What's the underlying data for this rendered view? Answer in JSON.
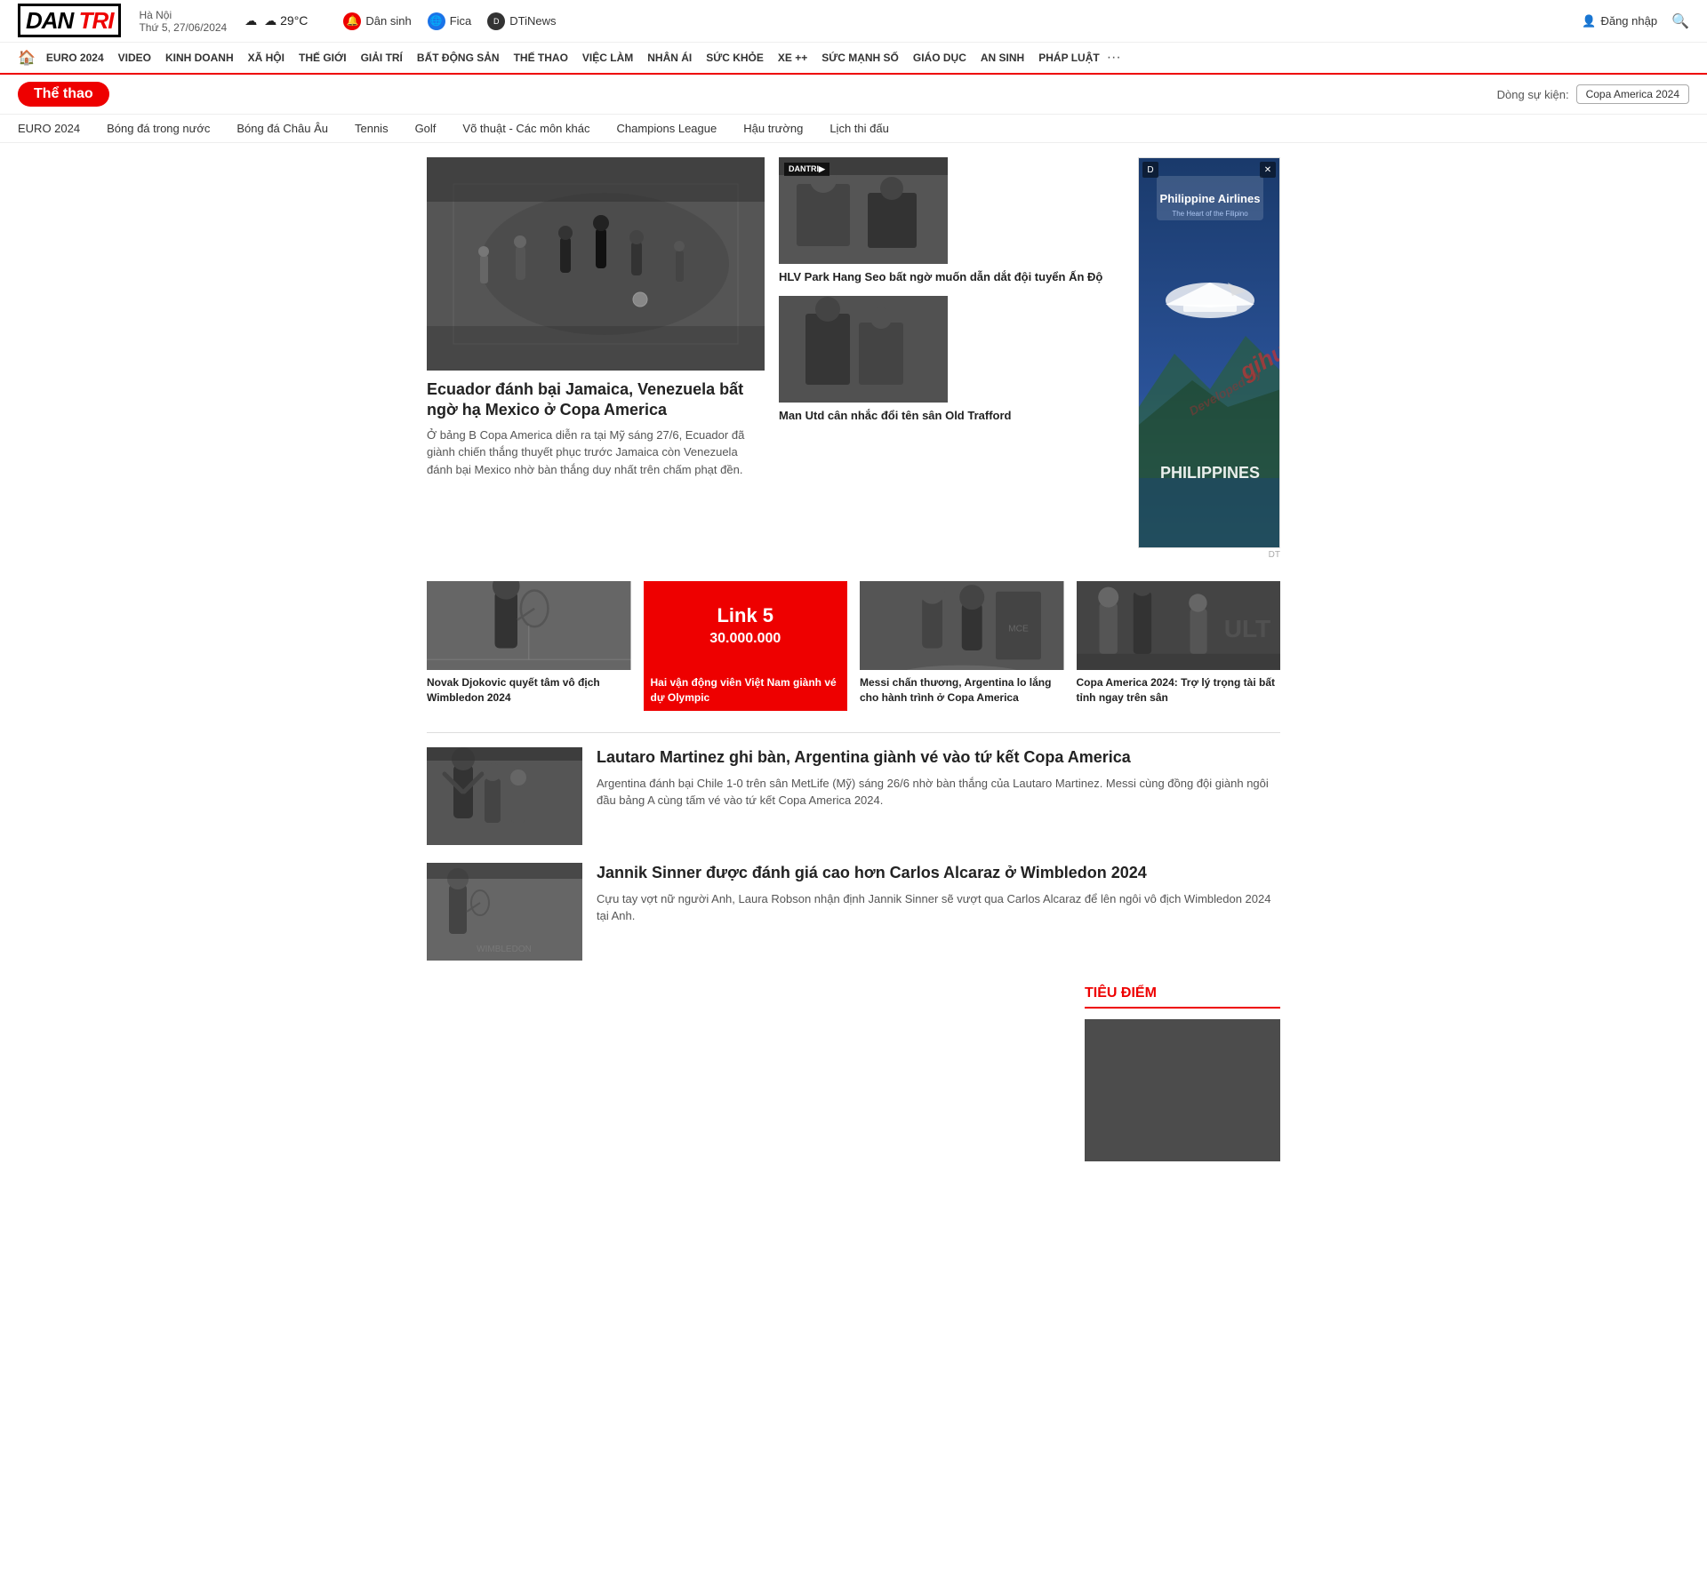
{
  "site": {
    "logo": "DAN TRI",
    "logo_dan": "DAN",
    "logo_tri": "TRI"
  },
  "header": {
    "day": "Thứ 5, 27/06/2024",
    "city": "Hà Nội",
    "weather": "☁ 29°C",
    "links": [
      {
        "id": "dan-sinh",
        "label": "Dân sinh",
        "icon": "🔔"
      },
      {
        "id": "fica",
        "label": "Fica",
        "icon": "🌐"
      },
      {
        "id": "dtinews",
        "label": "DTiNews",
        "icon": "D"
      }
    ],
    "login": "Đăng nhập"
  },
  "main_nav": {
    "items": [
      "EURO 2024",
      "VIDEO",
      "KINH DOANH",
      "XÃ HỘI",
      "THẾ GIỚI",
      "GIẢI TRÍ",
      "BẤT ĐỘNG SẢN",
      "THẾ THAO",
      "VIỆC LÀM",
      "NHÂN ÁI",
      "SỨC KHỎE",
      "XE ++",
      "SỨC MẠNH SỐ",
      "GIÁO DỤC",
      "AN SINH",
      "PHÁP LUẬT"
    ],
    "more": "..."
  },
  "section": {
    "badge": "Thể thao",
    "trending_label": "Dòng sự kiện:",
    "trending_tag": "Copa America 2024"
  },
  "sub_nav": {
    "items": [
      "EURO 2024",
      "Bóng đá trong nước",
      "Bóng đá Châu Âu",
      "Tennis",
      "Golf",
      "Võ thuật - Các môn khác",
      "Champions League",
      "Hậu trường",
      "Lịch thi đấu"
    ]
  },
  "main_article": {
    "title": "Ecuador đánh bại Jamaica, Venezuela bất ngờ hạ Mexico ở Copa America",
    "summary": "Ở bảng B Copa America diễn ra tại Mỹ sáng 27/6, Ecuador đã giành chiến thắng thuyết phục trước Jamaica còn Venezuela đánh bại Mexico nhờ bàn thắng duy nhất trên chấm phạt đền."
  },
  "side_articles": [
    {
      "title": "HLV Park Hang Seo bất ngờ muốn dẫn dắt đội tuyển Ấn Độ"
    },
    {
      "title": "Man Utd cân nhắc đổi tên sân Old Trafford"
    }
  ],
  "small_articles": [
    {
      "type": "normal",
      "title": "Novak Djokovic quyết tâm vô địch Wimbledon 2024"
    },
    {
      "type": "highlight",
      "link_text": "Link 5",
      "link_amount": "30.000.000",
      "title": "Hai vận động viên Việt Nam giành vé dự Olympic"
    },
    {
      "type": "normal",
      "title": "Messi chấn thương, Argentina lo lắng cho hành trình ở Copa America"
    },
    {
      "type": "normal",
      "title": "Copa America 2024: Trợ lý trọng tài bất tỉnh ngay trên sân"
    }
  ],
  "list_articles": [
    {
      "title": "Lautaro Martinez ghi bàn, Argentina giành vé vào tứ kết Copa America",
      "summary": "Argentina đánh bại Chile 1-0 trên sân MetLife (Mỹ) sáng 26/6 nhờ bàn thắng của Lautaro Martinez. Messi cùng đồng đội giành ngôi đầu bảng A cùng tấm vé vào tứ kết Copa America 2024."
    },
    {
      "title": "Jannik Sinner được đánh giá cao hơn Carlos Alcaraz ở Wimbledon 2024",
      "summary": "Cựu tay vợt nữ người Anh, Laura Robson nhận định Jannik Sinner sẽ vượt qua Carlos Alcaraz để lên ngôi vô địch Wimbledon 2024 tại Anh."
    }
  ],
  "tieu_diem": {
    "title": "TIÊU ĐIỂM"
  },
  "ad": {
    "brand": "Philippine Airlines",
    "tagline": "The Heart of the Filipino",
    "country": "PHILIPPINES"
  }
}
